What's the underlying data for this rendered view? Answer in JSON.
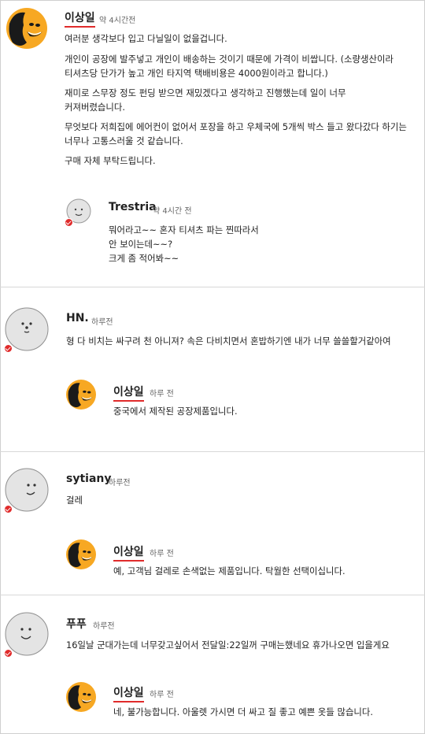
{
  "comments": [
    {
      "author": "이상일",
      "time": "약 4시간전",
      "paragraphs": [
        "여러분 생각보다 입고 다닐일이 없을겁니다.",
        "개인이 공장에 발주넣고 개인이 배송하는 것이기 때문에 가격이 비쌉니다. (소량생산이라",
        "티셔츠당 단가가 높고 개인 타지역 택배비용은 4000원이라고 합니다.)",
        "재미로 스무장 정도 펀딩 받으면 재밌겠다고 생각하고 진행했는데 일이 너무",
        "커져버렸습니다.",
        "무엇보다 저희집에 에어컨이 없어서 포장을 하고 우체국에 5개씩 박스 들고 왔다갔다 하기는",
        "너무나 고통스러울 것 같습니다.",
        "구매 자체 부탁드립니다."
      ],
      "reply": {
        "author": "Trestria",
        "time": "약 4시간 전",
        "lines": [
          "뭐어라고~~ 혼자 티셔츠 파는 찐따라서",
          "안 보이는데~~?",
          "크게 좀 적어봐~~"
        ]
      }
    },
    {
      "author": "HN.",
      "time": "하루전",
      "text": "형 다 비치는 싸구려 천 아니져? 속은 다비치면서 혼밥하기엔 내가 너무 쓸쓸할거같아여",
      "reply": {
        "author": "이상일",
        "time": "하루 전",
        "text": "중국에서 제작된 공장제품입니다."
      }
    },
    {
      "author": "sytiany",
      "time": "하루전",
      "text": "걸레",
      "reply": {
        "author": "이상일",
        "time": "하루 전",
        "text": "예, 고객님 걸레로 손색없는 제품입니다. 탁월한 선택이십니다."
      }
    },
    {
      "author": "푸푸",
      "time": "하루전",
      "text": "16일날 군대가는데 너무갖고싶어서 전달일:22일꺼 구매는했네요 휴가나오면 입을게요",
      "reply": {
        "author": "이상일",
        "time": "하루 전",
        "text": "네, 불가능합니다. 아울렛 가시면 더 싸고 질 좋고 예쁜 옷들 많습니다."
      }
    }
  ],
  "icons": {
    "owner_avatar": "yellow-character-avatar",
    "default_avatar": "gray-face-avatar",
    "badge": "red-check-badge"
  },
  "colors": {
    "accent": "#e02b2b",
    "owner_avatar_bg": "#f7a823",
    "default_avatar_bg": "#e4e4e4"
  }
}
